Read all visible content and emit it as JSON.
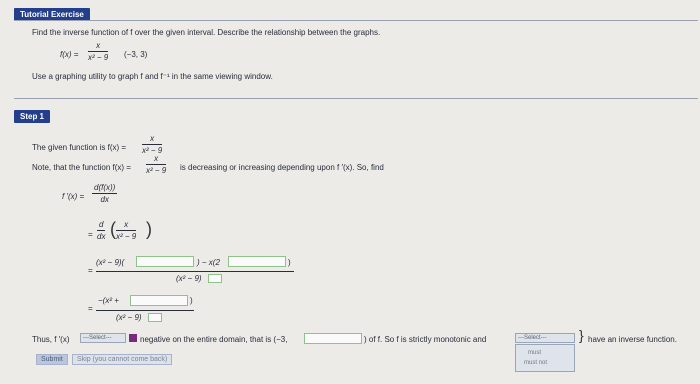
{
  "tutorial": {
    "header": "Tutorial Exercise",
    "instruction": "Find the inverse function of f over the given interval. Describe the relationship between the graphs.",
    "function_lhs": "f(x) =",
    "function_num": "x",
    "function_den": "x² − 9",
    "interval": "(−3, 3)",
    "use_graphing": "Use a graphing utility to graph f and f⁻¹ in the same viewing window."
  },
  "step": {
    "label": "Step 1",
    "given_text": "The given function is f(x) =",
    "given_num": "x",
    "given_den": "x² − 9",
    "note_text_a": "Note, that the function f(x) =",
    "note_num": "x",
    "note_den": "x² − 9",
    "note_text_b": "is decreasing or increasing depending upon f ′(x). So, find",
    "fprime_lhs": "f ′(x) =",
    "deriv_num": "d(f(x))",
    "deriv_den": "dx",
    "eq2_prefix": "=",
    "eq2_d": "d",
    "eq2_dx": "dx",
    "eq2_num": "x",
    "eq2_den": "x² − 9",
    "eq3_prefix": "=",
    "eq3_num_a": "(x² − 9)(",
    "eq3_num_b": ") − x(2",
    "eq3_num_c": ")",
    "eq3_den": "(x² − 9)",
    "eq4_prefix": "=",
    "eq4_num_a": "−(x² +",
    "eq4_num_b": ")",
    "eq4_den": "(x² − 9)",
    "thus_a": "Thus, f ′(x)",
    "select_1": "---Select---",
    "thus_b": "negative on the entire domain, that is (−3,",
    "thus_c": ") of f. So f is strictly monotonic and",
    "select_2": "---Select---",
    "select_2_opt1": "must",
    "select_2_opt2": "must not",
    "thus_d": "have an inverse function."
  },
  "buttons": {
    "submit": "Submit",
    "skip": "Skip (you cannot come back)"
  }
}
